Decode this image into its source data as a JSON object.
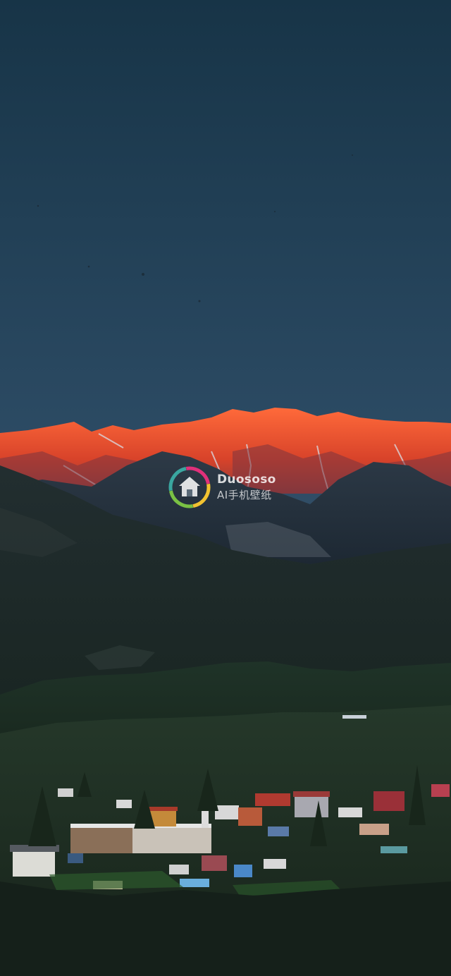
{
  "watermark": {
    "brand": "Duososo",
    "subtitle": "AI手机壁纸",
    "logo_icon": "house-in-ring-icon"
  },
  "colors": {
    "sky_top": "#1a3a4e",
    "sky_bottom": "#4a5b70",
    "peak_glow": "#f0552b",
    "forest": "#1c2d24"
  }
}
